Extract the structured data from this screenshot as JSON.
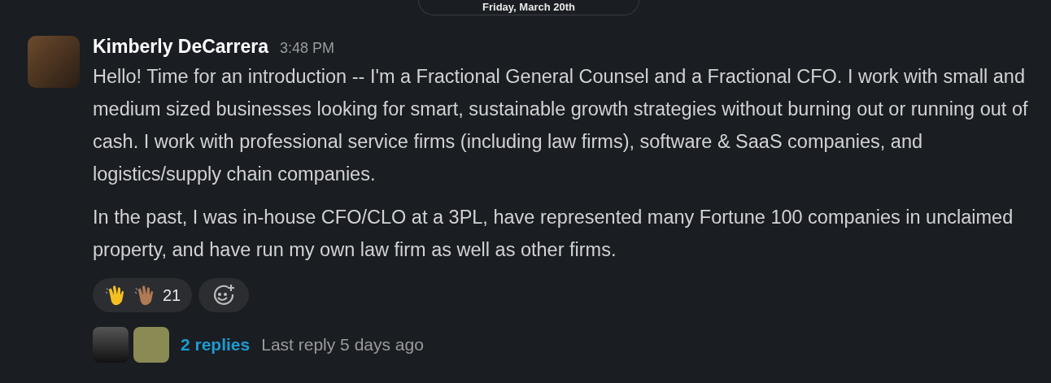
{
  "date_divider": {
    "label": "Friday, March 20th"
  },
  "message": {
    "author": "Kimberly DeCarrera",
    "time": "3:48 PM",
    "paragraphs": [
      "Hello! Time for an introduction -- I'm a Fractional General Counsel and a Fractional CFO. I work with small and medium sized businesses looking for smart, sustainable growth strategies without burning out or running out of cash. I work with professional service firms (including law firms), software & SaaS companies, and logistics/supply chain companies.",
      "In the past, I was in-house CFO/CLO at a 3PL, have represented many Fortune 100 companies in unclaimed property, and have run my own law firm as well as other firms."
    ],
    "reactions": [
      {
        "count": "21"
      }
    ],
    "thread": {
      "replies": "2 replies",
      "last_reply": "Last reply 5 days ago"
    }
  }
}
